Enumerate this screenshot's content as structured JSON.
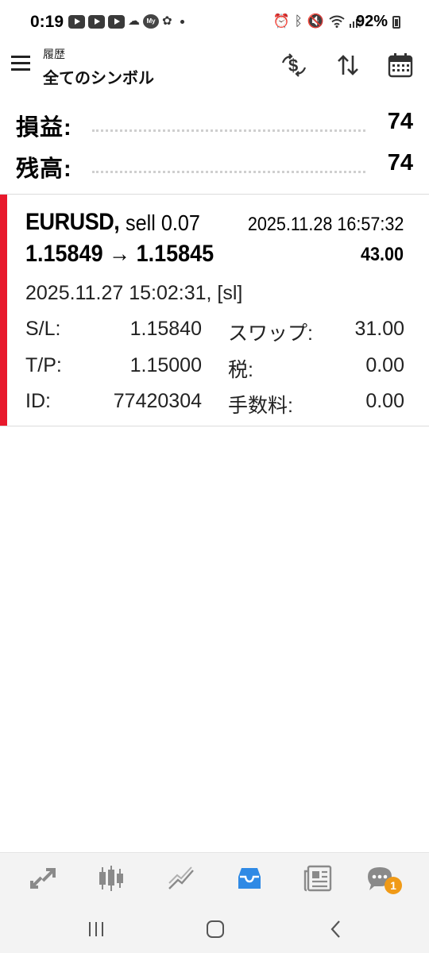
{
  "status_bar": {
    "time": "0:19",
    "battery": "92%",
    "my_badge": "My"
  },
  "toolbar": {
    "subtitle": "履歴",
    "title": "全てのシンボル",
    "icons": [
      "menu-icon",
      "currency-exchange-icon",
      "sort-icon",
      "calendar-icon"
    ]
  },
  "summary": {
    "profit_label": "損益:",
    "profit_value": "74",
    "balance_label": "残高:",
    "balance_value": "74"
  },
  "deal": {
    "symbol": "EURUSD,",
    "side": "sell 0.07",
    "close_time": "2025.11.28 16:57:32",
    "prices": "1.15849 → 1.15845",
    "profit": "43.00",
    "open_time": "2025.11.27 15:02:31, [sl]",
    "sl_label": "S/L:",
    "sl_value": "1.15840",
    "tp_label": "T/P:",
    "tp_value": "1.15000",
    "id_label": "ID:",
    "id_value": "77420304",
    "swap_label": "スワップ:",
    "swap_value": "31.00",
    "tax_label": "税:",
    "tax_value": "0.00",
    "commission_label": "手数料:",
    "commission_value": "0.00",
    "side_color": "#e8192c"
  },
  "bottom_nav": {
    "items": [
      "trade-icon",
      "quotes-icon",
      "chart-icon",
      "history-icon",
      "news-icon",
      "chat-icon"
    ],
    "active": "history-icon",
    "active_color": "#2f8ae5",
    "chat_badge": "1"
  }
}
